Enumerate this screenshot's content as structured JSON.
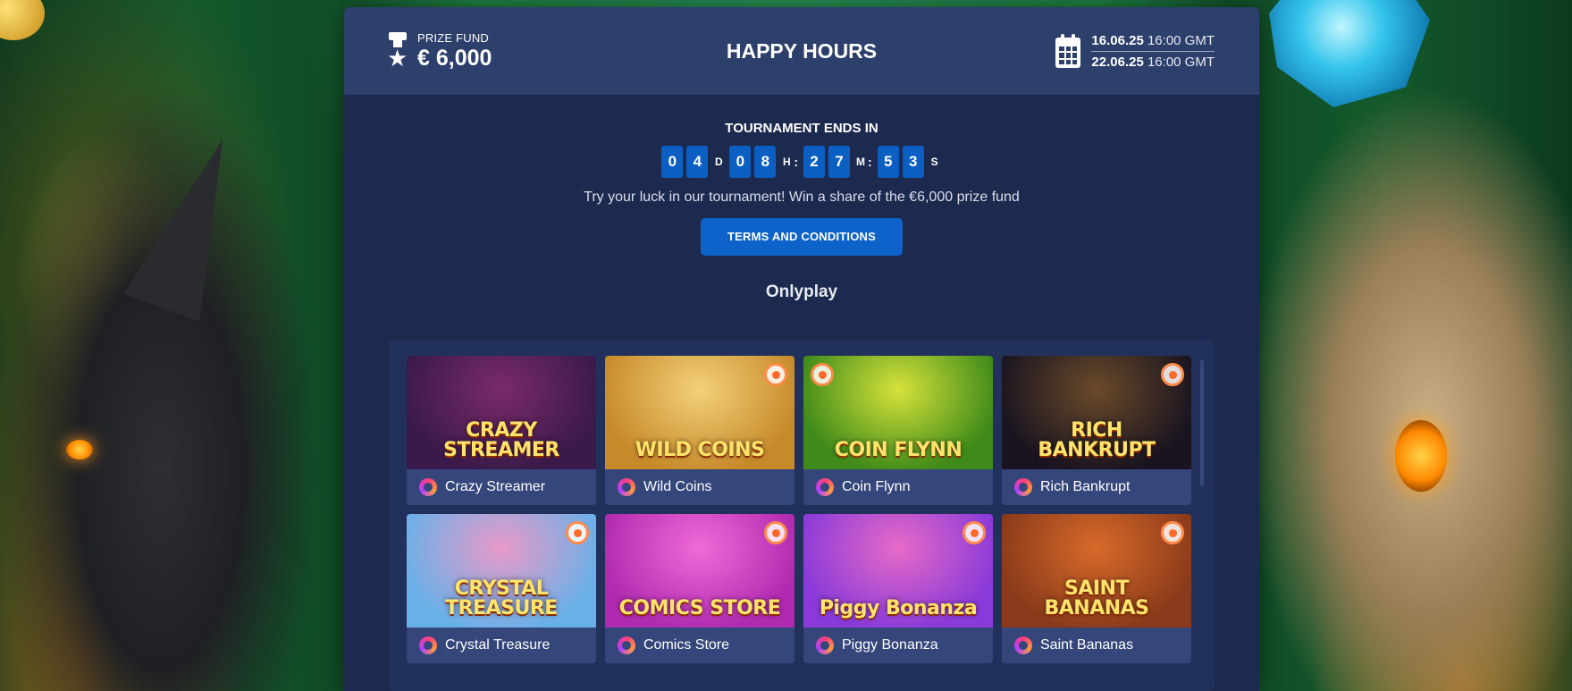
{
  "header": {
    "prize_label": "PRIZE FUND",
    "prize_value": "€ 6,000",
    "title": "HAPPY HOURS",
    "start_date": "16.06.25",
    "start_time": "16:00 GMT",
    "end_date": "22.06.25",
    "end_time": "16:00 GMT"
  },
  "countdown": {
    "label": "TOURNAMENT ENDS IN",
    "days": [
      "0",
      "4"
    ],
    "days_unit": "D",
    "hours": [
      "0",
      "8"
    ],
    "hours_unit": "H",
    "minutes": [
      "2",
      "7"
    ],
    "minutes_unit": "M",
    "seconds": [
      "5",
      "3"
    ],
    "seconds_unit": "S",
    "separator": ":"
  },
  "description": "Try your luck in our tournament! Win a share of the €6,000 prize fund",
  "terms_button": "TERMS AND CONDITIONS",
  "provider": "Onlyplay",
  "games": [
    {
      "name": "Crazy Streamer",
      "art_text": "CRAZY STREAMER",
      "bg": "#3a1a4a",
      "bg2": "#7a2a6a",
      "hot": false
    },
    {
      "name": "Wild Coins",
      "art_text": "WILD COINS",
      "bg": "#c78a2a",
      "bg2": "#f3d07a",
      "hot": true
    },
    {
      "name": "Coin Flynn",
      "art_text": "COIN FLYNN",
      "bg": "#3f8a1a",
      "bg2": "#d6e23a",
      "hot": true
    },
    {
      "name": "Rich Bankrupt",
      "art_text": "RICH BANKRUPT",
      "bg": "#1a1420",
      "bg2": "#6a4a2a",
      "hot": true
    },
    {
      "name": "Crystal Treasure",
      "art_text": "CRYSTAL TREASURE",
      "bg": "#6ab0e8",
      "bg2": "#e89ac8",
      "hot": true
    },
    {
      "name": "Comics Store",
      "art_text": "COMICS STORE",
      "bg": "#b02ab0",
      "bg2": "#f06ad8",
      "hot": true
    },
    {
      "name": "Piggy Bonanza",
      "art_text": "Piggy Bonanza",
      "bg": "#8a3ad8",
      "bg2": "#e66ac8",
      "hot": true
    },
    {
      "name": "Saint Bananas",
      "art_text": "SAINT BANANAS",
      "bg": "#8a3a1a",
      "bg2": "#d86a2a",
      "hot": true
    }
  ],
  "colors": {
    "panel_bg": "#1d2a4f",
    "header_bg": "#2d3f6b",
    "accent_blue": "#0d63c9",
    "card_bg": "#34467a"
  },
  "icons": [
    "prize-trophy-icon",
    "calendar-icon",
    "provider-logo-icon",
    "hot-badge-icon"
  ]
}
